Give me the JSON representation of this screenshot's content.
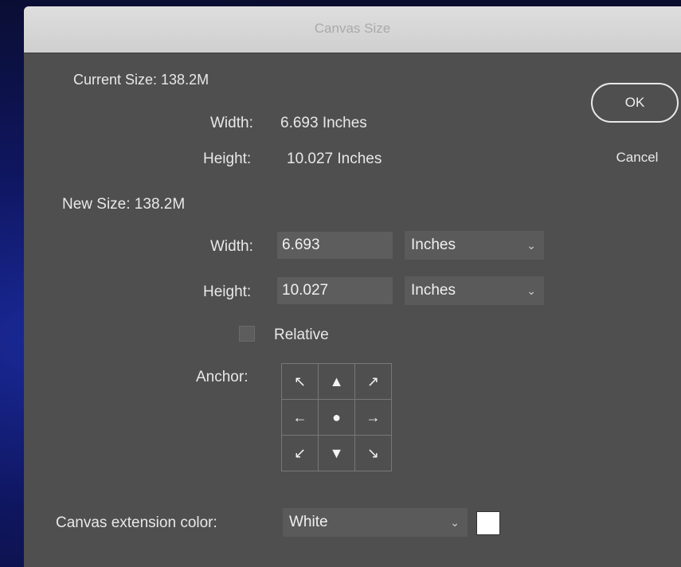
{
  "dialog": {
    "title": "Canvas Size",
    "ok_label": "OK",
    "cancel_label": "Cancel"
  },
  "current_size": {
    "heading": "Current Size: 138.2M",
    "width_label": "Width:",
    "width_value": "6.693 Inches",
    "height_label": "Height:",
    "height_value": "10.027 Inches"
  },
  "new_size": {
    "heading": "New Size: 138.2M",
    "width_label": "Width:",
    "width_value": "6.693",
    "width_unit": "Inches",
    "height_label": "Height:",
    "height_value": "10.027",
    "height_unit": "Inches",
    "relative_label": "Relative",
    "relative_checked": false,
    "anchor_label": "Anchor:",
    "anchor_cells": [
      "↖",
      "▲",
      "↗",
      "←",
      "●",
      "→",
      "↙",
      "▼",
      "↘"
    ]
  },
  "extension": {
    "label": "Canvas extension color:",
    "value": "White",
    "swatch_color": "#ffffff"
  },
  "icons": {
    "dropdown": "chevron-down-icon"
  }
}
